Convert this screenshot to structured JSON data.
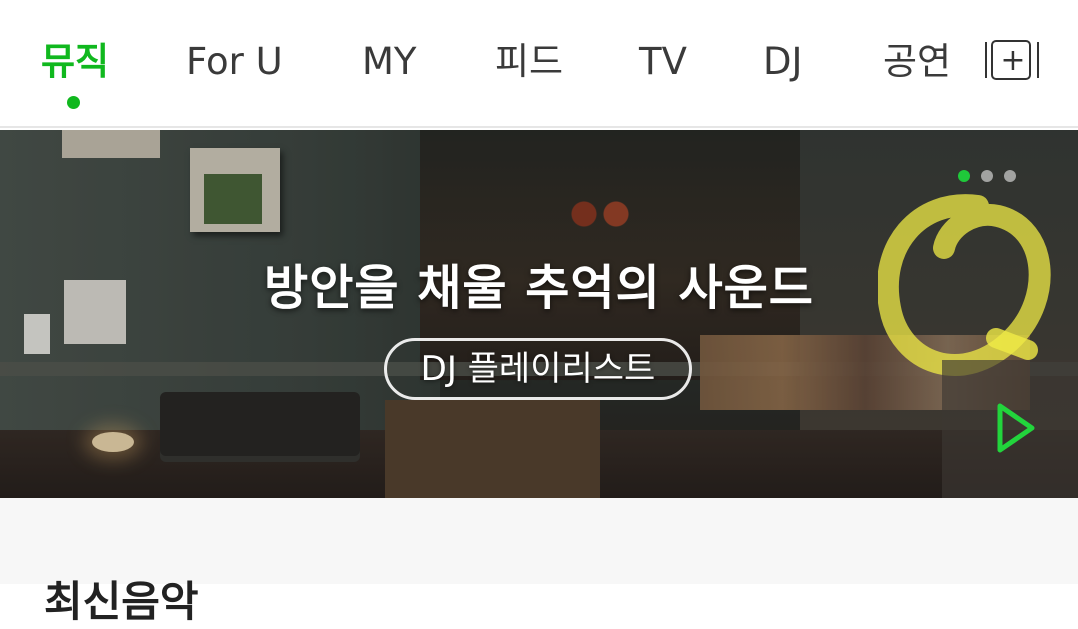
{
  "tabs": [
    {
      "label": "뮤직",
      "active": true
    },
    {
      "label": "For U",
      "active": false
    },
    {
      "label": "MY",
      "active": false
    },
    {
      "label": "피드",
      "active": false
    },
    {
      "label": "TV",
      "active": false
    },
    {
      "label": "DJ",
      "active": false
    },
    {
      "label": "공연",
      "active": false
    }
  ],
  "add_tab_symbol": "+",
  "banner": {
    "headline": "방안을 채울 추억의 사운드",
    "button_label": "DJ 플레이리스트",
    "pager": {
      "count": 3,
      "active_index": 0
    }
  },
  "section": {
    "title": "최신음악"
  },
  "colors": {
    "accent": "#10b81e",
    "text": "#3a3a3a"
  }
}
